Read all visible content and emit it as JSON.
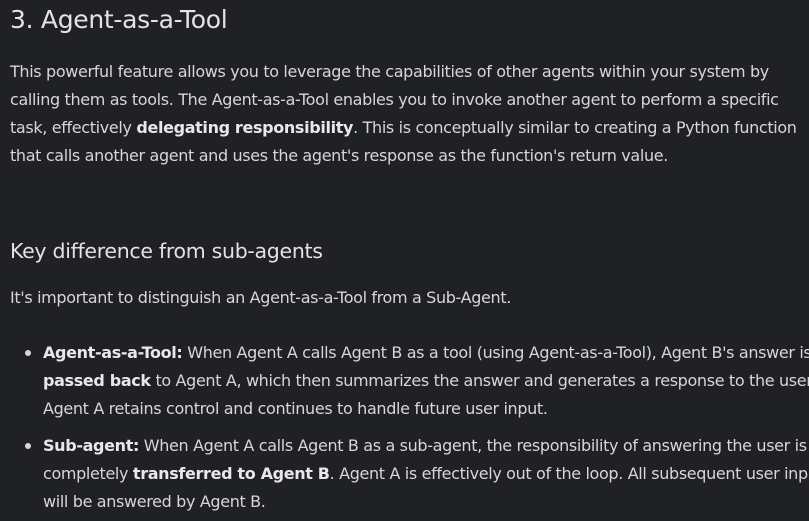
{
  "section": {
    "title": "3. Agent-as-a-Tool"
  },
  "intro": {
    "part1": "This powerful feature allows you to leverage the capabilities of other agents within your system by calling them as tools. The Agent-as-a-Tool enables you to invoke another agent to perform a specific task, effectively ",
    "bold": "delegating responsibility",
    "part2": ". This is conceptually similar to creating a Python function that calls another agent and uses the agent's response as the function's return value."
  },
  "key_difference": {
    "heading": "Key difference from sub-agents",
    "text": "It's important to distinguish an Agent-as-a-Tool from a Sub-Agent."
  },
  "list": [
    {
      "term": "Agent-as-a-Tool:",
      "text1": " When Agent A calls Agent B as a tool (using Agent-as-a-Tool), Agent B's answer is ",
      "bold": "passed back",
      "text2": " to Agent A, which then summarizes the answer and generates a response to the user. Agent A retains control and continues to handle future user input."
    },
    {
      "term": "Sub-agent:",
      "text1": " When Agent A calls Agent B as a sub-agent, the responsibility of answering the user is completely ",
      "bold": "transferred to Agent B",
      "text2": ". Agent A is effectively out of the loop. All subsequent user input will be answered by Agent B."
    }
  ]
}
